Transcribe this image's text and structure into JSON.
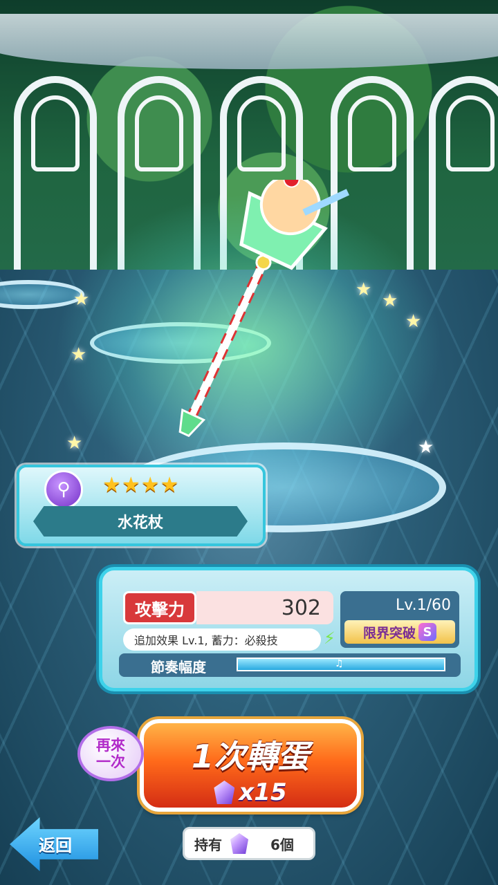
{
  "item": {
    "name": "水花杖",
    "rarity_stars": "★★★★",
    "type_icon": "magic-wand-icon"
  },
  "stats": {
    "attack_label": "攻擊力",
    "attack_value": "302",
    "level": "Lv.1/60",
    "limit_break_label": "限界突破",
    "limit_break_rank": "S",
    "effect_text": "追加效果 Lv.1, 蓄力：必殺技",
    "rhythm_label": "節奏幅度",
    "rhythm_fill": 1.0
  },
  "gacha": {
    "again_label_line1": "再來",
    "again_label_line2": "一次",
    "roll_label": "1次轉蛋",
    "cost": "x15"
  },
  "footer": {
    "back_label": "返回",
    "owned_label": "持有",
    "owned_count": "6個"
  },
  "colors": {
    "panel_border": "#3ed2ea",
    "attack_red": "#d8393b",
    "button_orange": "#ff6a1a",
    "back_blue": "#1e8fe0"
  }
}
